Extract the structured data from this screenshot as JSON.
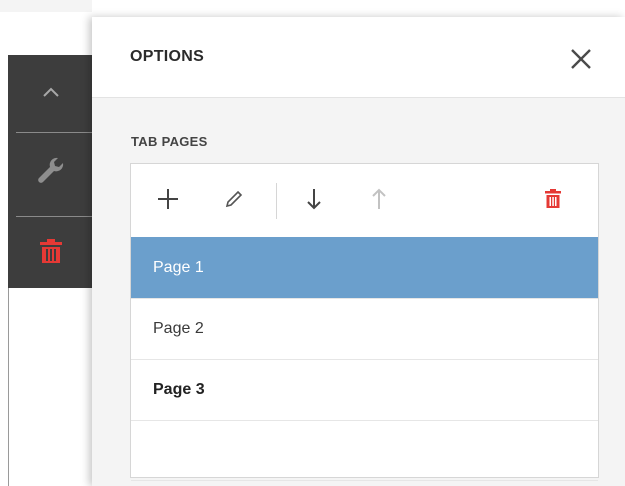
{
  "left_toolbar": {
    "buttons": [
      {
        "icon": "chevron-up-icon"
      },
      {
        "icon": "wrench-icon"
      },
      {
        "icon": "trash-icon",
        "color": "#e53935"
      }
    ]
  },
  "panel": {
    "title": "OPTIONS",
    "close_icon": "close-icon",
    "section_label": "TAB PAGES",
    "toolbar": {
      "add_icon": "plus-icon",
      "edit_icon": "pencil-icon",
      "move_down_icon": "arrow-down-icon",
      "move_up_icon": "arrow-up-icon",
      "delete_icon": "trash-icon",
      "delete_color": "#e53935"
    },
    "pages": [
      {
        "label": "Page 1",
        "selected": true
      },
      {
        "label": "Page 2",
        "selected": false
      },
      {
        "label": "Page 3",
        "selected": false,
        "bold": true
      }
    ]
  },
  "colors": {
    "selected_row": "#6b9fcc",
    "left_toolbar_bg": "#3d3d3d",
    "danger": "#e53935"
  }
}
